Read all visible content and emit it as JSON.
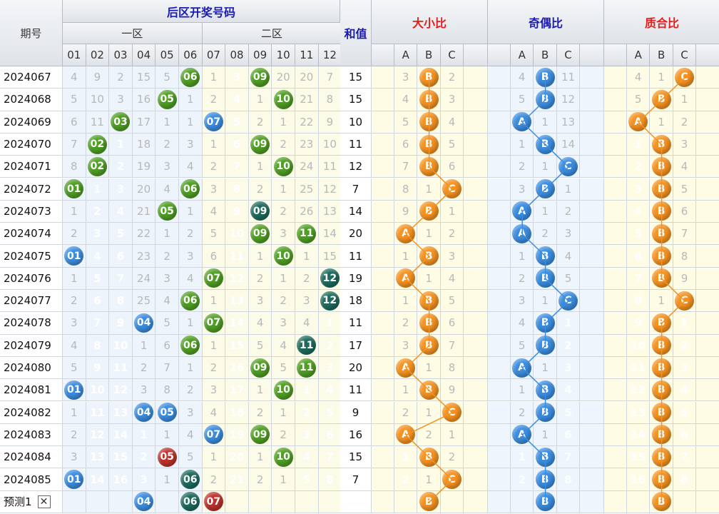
{
  "header": {
    "issue_label": "期号",
    "main_title": "后区开奖号码",
    "zone1": "一区",
    "zone2": "二区",
    "sum_label": "和值",
    "ratios": [
      {
        "label": "大小比",
        "color": "#e0201e"
      },
      {
        "label": "奇偶比",
        "color": "#1a1ab4"
      },
      {
        "label": "质合比",
        "color": "#e0201e"
      }
    ],
    "ball_headers": [
      "01",
      "02",
      "03",
      "04",
      "05",
      "06",
      "07",
      "08",
      "09",
      "10",
      "11",
      "12"
    ],
    "ratio_headers": [
      "A",
      "B",
      "C"
    ]
  },
  "colors": {
    "ball_green": "#4f9f23",
    "ball_blue": "#3b8de0",
    "ball_teal": "#1d6b5d",
    "ball_red": "#c0302a",
    "ratio_orange": "#f59220",
    "ratio_blue": "#3b8de0",
    "bg_zone1": "#eef4fb",
    "bg_zone2": "#fbfbe8",
    "bg_ratio_a": "#fffce6",
    "bg_ratio_b": "#eef5fc"
  },
  "rows": [
    {
      "issue": "2024067",
      "sum": "15",
      "cells": [
        "4",
        "9",
        "2",
        "15",
        "5",
        "b:06:g",
        "1",
        "3",
        "b:09:g",
        "20",
        "20",
        "7"
      ],
      "r1": [
        "3",
        "b:B",
        "2"
      ],
      "r2": [
        "4",
        "b:B",
        "11"
      ],
      "r3": [
        "4",
        "1",
        "b:C"
      ]
    },
    {
      "issue": "2024068",
      "sum": "15",
      "cells": [
        "5",
        "10",
        "3",
        "16",
        "b:05:g",
        "1",
        "2",
        "4",
        "1",
        "b:10:g",
        "21",
        "8"
      ],
      "r1": [
        "4",
        "b:B",
        "3"
      ],
      "r2": [
        "5",
        "b:B",
        "12"
      ],
      "r3": [
        "5",
        "b:B",
        "1"
      ]
    },
    {
      "issue": "2024069",
      "sum": "10",
      "cells": [
        "6",
        "11",
        "b:03:g",
        "17",
        "1",
        "1",
        "b:07:b",
        "5",
        "2",
        "1",
        "22",
        "9"
      ],
      "r1": [
        "5",
        "b:B",
        "4"
      ],
      "r2": [
        "b:A",
        "1",
        "13"
      ],
      "r3": [
        "b:A",
        "1",
        "2"
      ]
    },
    {
      "issue": "2024070",
      "sum": "11",
      "cells": [
        "7",
        "b:02:g",
        "1",
        "18",
        "2",
        "3",
        "1",
        "6",
        "b:09:g",
        "2",
        "23",
        "10"
      ],
      "r1": [
        "6",
        "b:B",
        "5"
      ],
      "r2": [
        "1",
        "b:B",
        "14"
      ],
      "r3": [
        "1",
        "b:B",
        "3"
      ]
    },
    {
      "issue": "2024071",
      "sum": "12",
      "cells": [
        "8",
        "b:02:g",
        "2",
        "19",
        "3",
        "4",
        "2",
        "7",
        "1",
        "b:10:g",
        "24",
        "11"
      ],
      "r1": [
        "7",
        "b:B",
        "6"
      ],
      "r2": [
        "2",
        "1",
        "b:C"
      ],
      "r3": [
        "2",
        "b:B",
        "4"
      ]
    },
    {
      "issue": "2024072",
      "sum": "7",
      "cells": [
        "b:01:g",
        "1",
        "3",
        "20",
        "4",
        "b:06:g",
        "3",
        "8",
        "2",
        "1",
        "25",
        "12"
      ],
      "r1": [
        "8",
        "1",
        "b:C"
      ],
      "r2": [
        "3",
        "b:B",
        "1"
      ],
      "r3": [
        "3",
        "b:B",
        "5"
      ]
    },
    {
      "issue": "2024073",
      "sum": "14",
      "cells": [
        "1",
        "2",
        "4",
        "21",
        "b:05:g",
        "1",
        "4",
        "9",
        "b:09:t",
        "2",
        "26",
        "13"
      ],
      "r1": [
        "9",
        "b:B",
        "1"
      ],
      "r2": [
        "b:A",
        "1",
        "2"
      ],
      "r3": [
        "4",
        "b:B",
        "6"
      ]
    },
    {
      "issue": "2024074",
      "sum": "20",
      "cells": [
        "2",
        "3",
        "5",
        "22",
        "1",
        "2",
        "5",
        "10",
        "b:09:g",
        "3",
        "b:11:g",
        "14"
      ],
      "r1": [
        "b:A",
        "1",
        "2"
      ],
      "r2": [
        "b:A",
        "2",
        "3"
      ],
      "r3": [
        "5",
        "b:B",
        "7"
      ]
    },
    {
      "issue": "2024075",
      "sum": "11",
      "cells": [
        "b:01:b",
        "4",
        "6",
        "23",
        "2",
        "3",
        "6",
        "11",
        "1",
        "b:10:g",
        "1",
        "15"
      ],
      "r1": [
        "1",
        "b:B",
        "3"
      ],
      "r2": [
        "1",
        "b:B",
        "4"
      ],
      "r3": [
        "6",
        "b:B",
        "8"
      ]
    },
    {
      "issue": "2024076",
      "sum": "19",
      "cells": [
        "1",
        "5",
        "7",
        "24",
        "3",
        "4",
        "b:07:g",
        "12",
        "2",
        "1",
        "2",
        "b:12:t"
      ],
      "r1": [
        "b:A",
        "1",
        "4"
      ],
      "r2": [
        "2",
        "b:B",
        "5"
      ],
      "r3": [
        "7",
        "b:B",
        "9"
      ]
    },
    {
      "issue": "2024077",
      "sum": "18",
      "cells": [
        "2",
        "6",
        "8",
        "25",
        "4",
        "b:06:g",
        "1",
        "13",
        "3",
        "2",
        "3",
        "b:12:t"
      ],
      "r1": [
        "1",
        "b:B",
        "5"
      ],
      "r2": [
        "3",
        "1",
        "b:C"
      ],
      "r3": [
        "8",
        "1",
        "b:C"
      ]
    },
    {
      "issue": "2024078",
      "sum": "11",
      "cells": [
        "3",
        "7",
        "9",
        "b:04:b",
        "5",
        "1",
        "b:07:g",
        "14",
        "4",
        "3",
        "4",
        "1"
      ],
      "r1": [
        "2",
        "b:B",
        "6"
      ],
      "r2": [
        "4",
        "b:B",
        "1"
      ],
      "r3": [
        "9",
        "b:B",
        "1"
      ]
    },
    {
      "issue": "2024079",
      "sum": "17",
      "cells": [
        "4",
        "8",
        "10",
        "1",
        "6",
        "b:06:g",
        "1",
        "15",
        "5",
        "4",
        "b:11:t",
        "2"
      ],
      "r1": [
        "3",
        "b:B",
        "7"
      ],
      "r2": [
        "5",
        "b:B",
        "2"
      ],
      "r3": [
        "10",
        "b:B",
        "2"
      ]
    },
    {
      "issue": "2024080",
      "sum": "20",
      "cells": [
        "5",
        "9",
        "11",
        "2",
        "7",
        "1",
        "2",
        "16",
        "b:09:g",
        "5",
        "b:11:g",
        "3"
      ],
      "r1": [
        "b:A",
        "1",
        "8"
      ],
      "r2": [
        "b:A",
        "1",
        "3"
      ],
      "r3": [
        "11",
        "b:B",
        "3"
      ]
    },
    {
      "issue": "2024081",
      "sum": "11",
      "cells": [
        "b:01:b",
        "10",
        "12",
        "3",
        "8",
        "2",
        "3",
        "17",
        "1",
        "b:10:g",
        "1",
        "4"
      ],
      "r1": [
        "1",
        "b:B",
        "9"
      ],
      "r2": [
        "1",
        "b:B",
        "4"
      ],
      "r3": [
        "12",
        "b:B",
        "4"
      ]
    },
    {
      "issue": "2024082",
      "sum": "9",
      "cells": [
        "1",
        "11",
        "13",
        "b:04:b",
        "b:05:b",
        "3",
        "4",
        "18",
        "2",
        "1",
        "2",
        "5"
      ],
      "r1": [
        "2",
        "1",
        "b:C"
      ],
      "r2": [
        "2",
        "b:B",
        "5"
      ],
      "r3": [
        "13",
        "b:B",
        "5"
      ]
    },
    {
      "issue": "2024083",
      "sum": "16",
      "cells": [
        "2",
        "12",
        "14",
        "1",
        "1",
        "4",
        "b:07:b",
        "19",
        "b:09:g",
        "2",
        "3",
        "6"
      ],
      "r1": [
        "b:A",
        "2",
        "1"
      ],
      "r2": [
        "b:A",
        "1",
        "6"
      ],
      "r3": [
        "14",
        "b:B",
        "6"
      ]
    },
    {
      "issue": "2024084",
      "sum": "15",
      "cells": [
        "3",
        "13",
        "15",
        "2",
        "b:05:r",
        "5",
        "1",
        "20",
        "1",
        "b:10:g",
        "4",
        "7"
      ],
      "r1": [
        "1",
        "b:B",
        "2"
      ],
      "r2": [
        "1",
        "b:B",
        "7"
      ],
      "r3": [
        "15",
        "b:B",
        "7"
      ]
    },
    {
      "issue": "2024085",
      "sum": "7",
      "cells": [
        "b:01:b",
        "14",
        "16",
        "3",
        "1",
        "b:06:t",
        "2",
        "21",
        "2",
        "1",
        "5",
        "8"
      ],
      "r1": [
        "2",
        "1",
        "b:C"
      ],
      "r2": [
        "2",
        "b:B",
        "8"
      ],
      "r3": [
        "16",
        "b:B",
        "8"
      ]
    }
  ],
  "predict": {
    "label": "预测1",
    "close": "✕",
    "cells": [
      "",
      "",
      "",
      "b:04:b",
      "",
      "b:06:t",
      "b:07:r",
      "",
      "",
      "",
      "",
      ""
    ],
    "r1": [
      "",
      "b:B",
      ""
    ],
    "r2": [
      "",
      "b:B",
      ""
    ],
    "r3": [
      "",
      "b:B",
      ""
    ]
  }
}
